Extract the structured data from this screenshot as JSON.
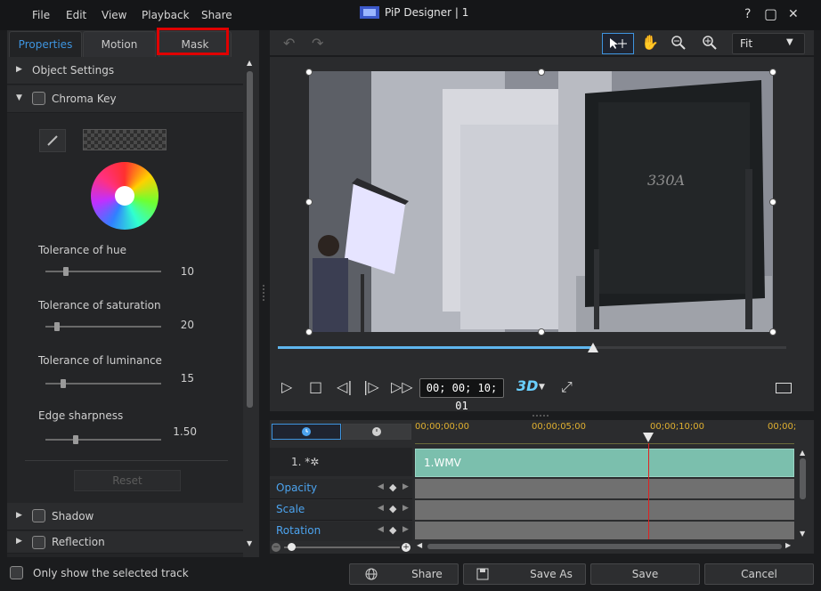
{
  "window": {
    "title": "PiP Designer | 1",
    "menu": [
      "File",
      "Edit",
      "View",
      "Playback",
      "Share"
    ],
    "controls": {
      "help": "?",
      "maximize": "▢",
      "close": "✕",
      "minimize": "—"
    }
  },
  "tabs": {
    "properties": "Properties",
    "motion": "Motion",
    "mask": "Mask"
  },
  "sections": {
    "object_settings": "Object Settings",
    "chroma_key": "Chroma Key",
    "shadow": "Shadow",
    "reflection": "Reflection"
  },
  "chroma": {
    "params": [
      {
        "label": "Tolerance of hue",
        "value": "10",
        "level": 0.16
      },
      {
        "label": "Tolerance of saturation",
        "value": "20",
        "level": 0.08
      },
      {
        "label": "Tolerance of luminance",
        "value": "15",
        "level": 0.14
      },
      {
        "label": "Edge sharpness",
        "value": "1.50",
        "level": 0.25
      }
    ],
    "reset_label": "Reset"
  },
  "preview": {
    "zoom_option": "Fit",
    "timecode": "00; 00; 10; 01",
    "mode_3d": "3D",
    "progress": 0.62
  },
  "timeline": {
    "ruler": [
      "00;00;00;00",
      "00;00;05;00",
      "00;00;10;00",
      "00;00;"
    ],
    "track_label": "1. *✲",
    "clip_name": "1.WMV",
    "properties": [
      "Opacity",
      "Scale",
      "Rotation"
    ]
  },
  "bottom": {
    "only_selected_label": "Only show the selected track",
    "share_label": "Share",
    "save_as_label": "Save As",
    "save_label": "Save",
    "cancel_label": "Cancel"
  },
  "colors": {
    "accent": "#3e94df",
    "highlight": "#e00000",
    "clip": "#7bbfad"
  }
}
